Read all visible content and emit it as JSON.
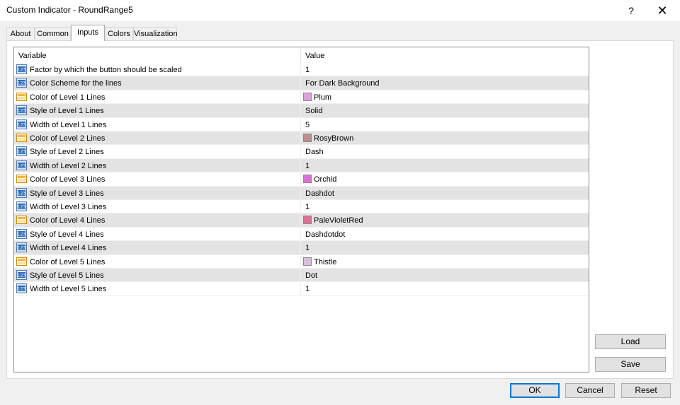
{
  "window": {
    "title": "Custom Indicator - RoundRange5",
    "help_label": "?",
    "close_label": "✕"
  },
  "tabs": [
    {
      "label": "About"
    },
    {
      "label": "Common"
    },
    {
      "label": "Inputs"
    },
    {
      "label": "Colors"
    },
    {
      "label": "Visualization"
    }
  ],
  "active_tab": "Inputs",
  "grid": {
    "headers": {
      "variable": "Variable",
      "value": "Value"
    },
    "rows": [
      {
        "label": "Factor by which the button should be scaled",
        "value": "1",
        "icon": "number-icon"
      },
      {
        "label": "Color Scheme for the lines",
        "value": "For Dark Background",
        "icon": "number-icon"
      },
      {
        "label": "Color of Level 1 Lines",
        "value": "Plum",
        "icon": "color-icon",
        "color": "#dda0dd"
      },
      {
        "label": "Style of Level 1 Lines",
        "value": "Solid",
        "icon": "number-icon"
      },
      {
        "label": "Width of Level 1 Lines",
        "value": "5",
        "icon": "number-icon"
      },
      {
        "label": "Color of Level 2 Lines",
        "value": "RosyBrown",
        "icon": "color-icon",
        "color": "#bc8f8f"
      },
      {
        "label": "Style of Level 2 Lines",
        "value": "Dash",
        "icon": "number-icon"
      },
      {
        "label": "Width of Level 2 Lines",
        "value": "1",
        "icon": "number-icon"
      },
      {
        "label": "Color of Level 3 Lines",
        "value": "Orchid",
        "icon": "color-icon",
        "color": "#da70d6"
      },
      {
        "label": "Style of Level 3 Lines",
        "value": "Dashdot",
        "icon": "number-icon"
      },
      {
        "label": "Width of Level 3 Lines",
        "value": "1",
        "icon": "number-icon"
      },
      {
        "label": "Color of Level 4 Lines",
        "value": "PaleVioletRed",
        "icon": "color-icon",
        "color": "#db7093"
      },
      {
        "label": "Style of Level 4 Lines",
        "value": "Dashdotdot",
        "icon": "number-icon"
      },
      {
        "label": "Width of Level 4 Lines",
        "value": "1",
        "icon": "number-icon"
      },
      {
        "label": "Color of Level 5 Lines",
        "value": "Thistle",
        "icon": "color-icon",
        "color": "#d8bfd8"
      },
      {
        "label": "Style of Level 5 Lines",
        "value": "Dot",
        "icon": "number-icon"
      },
      {
        "label": "Width of Level 5 Lines",
        "value": "1",
        "icon": "number-icon"
      }
    ]
  },
  "side_buttons": {
    "load": "Load",
    "save": "Save"
  },
  "footer": {
    "ok": "OK",
    "cancel": "Cancel",
    "reset": "Reset"
  },
  "colors": {
    "accent": "#0078d7",
    "alt_row": "#e3e3e3"
  }
}
